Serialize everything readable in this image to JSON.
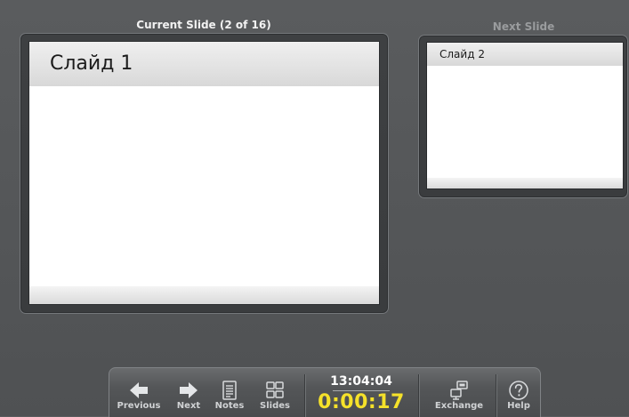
{
  "presenter": {
    "current_heading": "Current Slide (2 of 16)",
    "next_heading": "Next Slide",
    "current_slide_title": "Слайд 1",
    "next_slide_title": "Слайд 2"
  },
  "toolbar": {
    "previous_label": "Previous",
    "next_label": "Next",
    "notes_label": "Notes",
    "slides_label": "Slides",
    "clock": "13:04:04",
    "elapsed": "0:00:17",
    "exchange_label": "Exchange",
    "help_label": "Help"
  },
  "icons": {
    "previous": "arrow-left-icon",
    "next": "arrow-right-icon",
    "notes": "notes-icon",
    "slides": "slides-grid-icon",
    "exchange": "exchange-icon",
    "help": "help-icon"
  },
  "colors": {
    "background": "#555759",
    "elapsed_timer": "#f5e12a",
    "clock": "#ffffff",
    "current_heading": "#f2f2f2",
    "next_heading": "#9a9c9e"
  }
}
